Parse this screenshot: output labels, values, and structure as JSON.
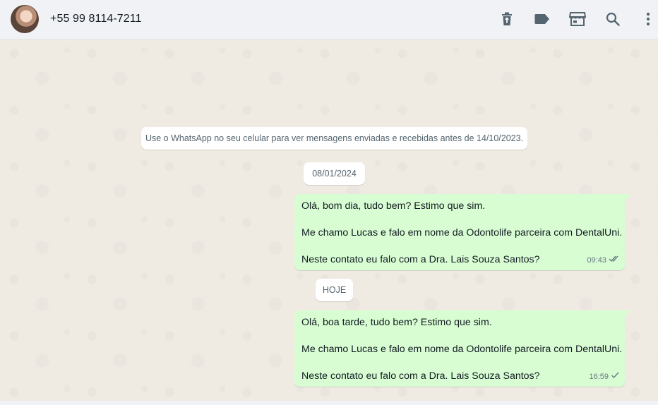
{
  "header": {
    "contact_name": "+55 99 8114-7211",
    "icons": [
      "delete-icon",
      "label-icon",
      "store-icon",
      "search-icon",
      "menu-icon"
    ]
  },
  "chat": {
    "system_message": "Use o WhatsApp no seu celular para ver mensagens enviadas e recebidas antes de 14/10/2023.",
    "date_1": "08/01/2024",
    "date_2": "HOJE",
    "messages": [
      {
        "lines": [
          "Olá, bom dia, tudo bem? Estimo que sim.",
          "Me chamo Lucas e falo em nome da Odontolife parceira com DentalUni.",
          "Neste contato eu falo com a Dra. Lais Souza Santos?"
        ],
        "time": "09:43",
        "status": "double-check"
      },
      {
        "lines": [
          "Olá, boa tarde, tudo bem? Estimo que sim.",
          "Me chamo Lucas e falo em nome da Odontolife parceira com DentalUni.",
          "Neste contato eu falo com a Dra. Lais Souza Santos?"
        ],
        "time": "16:59",
        "status": "single-check"
      }
    ]
  },
  "colors": {
    "header_bg": "#f0f2f5",
    "chat_bg": "#efeae2",
    "outgoing_bubble": "#d9fdd3",
    "icon": "#54656f"
  }
}
